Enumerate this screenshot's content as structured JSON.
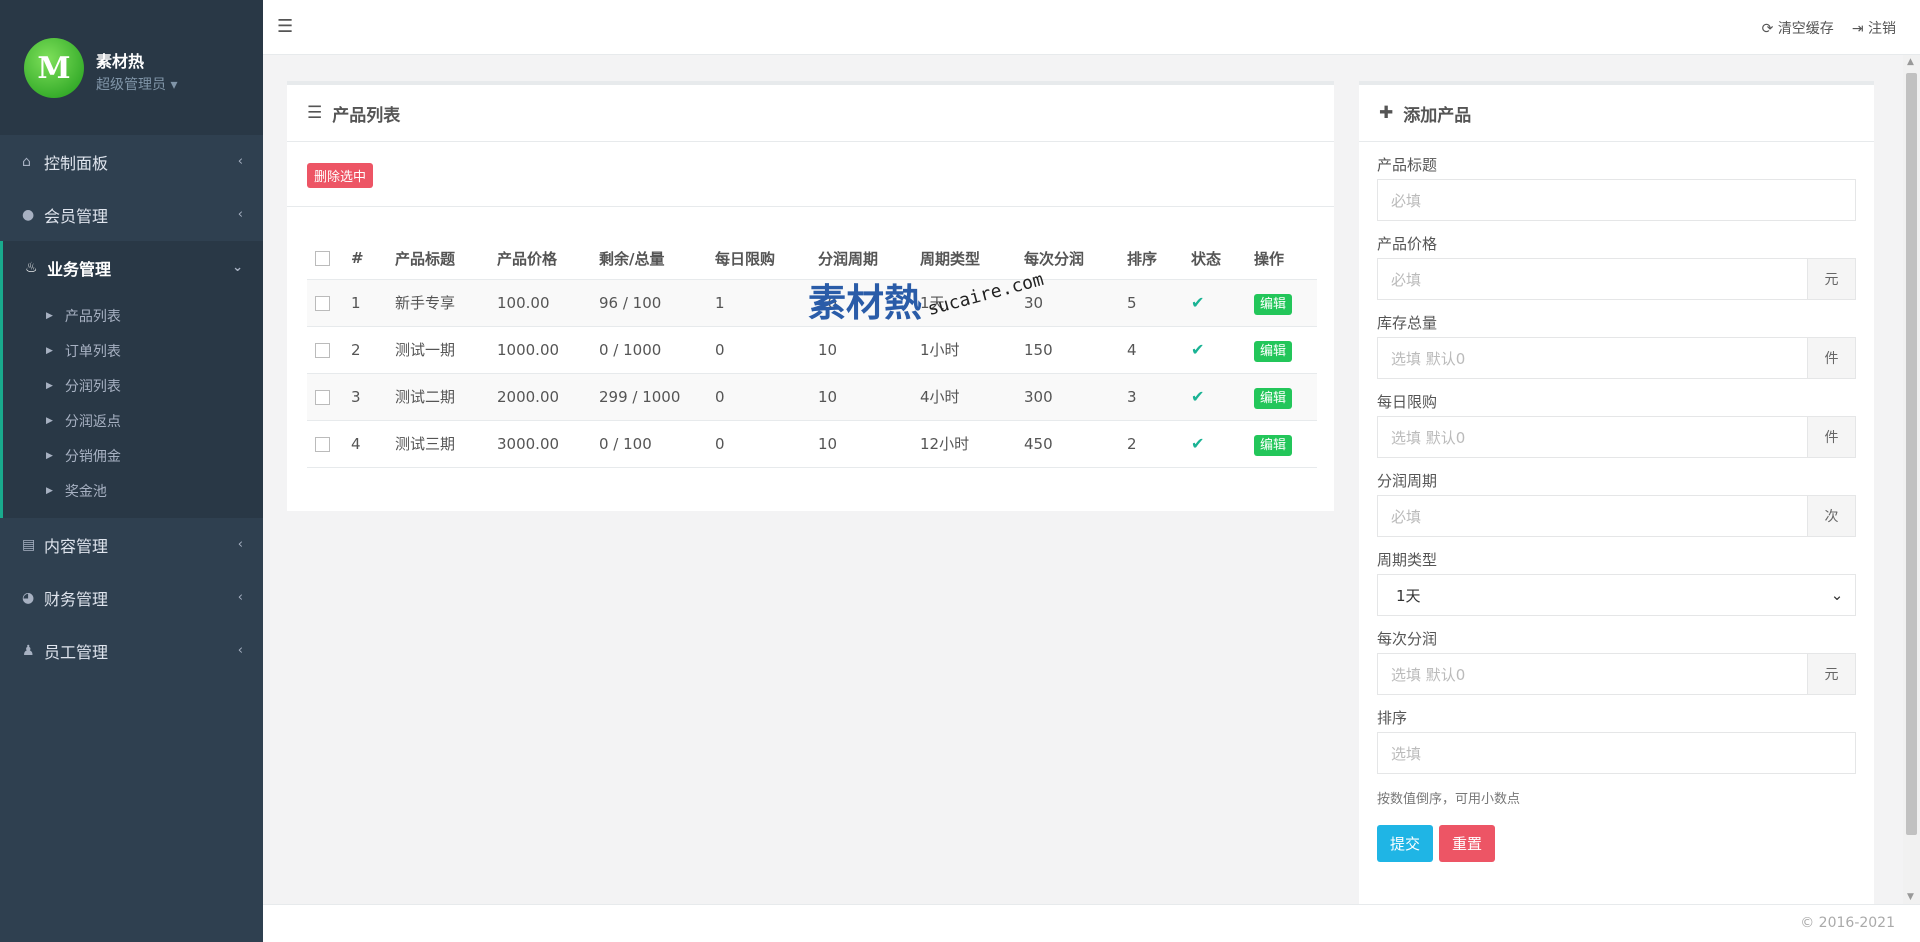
{
  "profile": {
    "name": "素材热",
    "role": "超级管理员"
  },
  "nav": {
    "items": [
      {
        "label": "控制面板"
      },
      {
        "label": "会员管理"
      },
      {
        "label": "业务管理"
      },
      {
        "label": "内容管理"
      },
      {
        "label": "财务管理"
      },
      {
        "label": "员工管理"
      }
    ],
    "submenu": [
      "产品列表",
      "订单列表",
      "分润列表",
      "分润返点",
      "分销佣金",
      "奖金池"
    ]
  },
  "topbar": {
    "clear_cache": "清空缓存",
    "logout": "注销"
  },
  "product_list": {
    "title": "产品列表",
    "delete_selected": "删除选中",
    "columns": [
      "#",
      "产品标题",
      "产品价格",
      "剩余/总量",
      "每日限购",
      "分润周期",
      "周期类型",
      "每次分润",
      "排序",
      "状态",
      "操作"
    ],
    "rows": [
      {
        "id": "1",
        "title": "新手专享",
        "price": "100.00",
        "stock": "96 / 100",
        "daily": "1",
        "cycle": "10",
        "type": "1天",
        "profit": "30",
        "sort": "5",
        "edit": "编辑"
      },
      {
        "id": "2",
        "title": "测试一期",
        "price": "1000.00",
        "stock": "0 / 1000",
        "daily": "0",
        "cycle": "10",
        "type": "1小时",
        "profit": "150",
        "sort": "4",
        "edit": "编辑"
      },
      {
        "id": "3",
        "title": "测试二期",
        "price": "2000.00",
        "stock": "299 / 1000",
        "daily": "0",
        "cycle": "10",
        "type": "4小时",
        "profit": "300",
        "sort": "3",
        "edit": "编辑"
      },
      {
        "id": "4",
        "title": "测试三期",
        "price": "3000.00",
        "stock": "0 / 100",
        "daily": "0",
        "cycle": "10",
        "type": "12小时",
        "profit": "450",
        "sort": "2",
        "edit": "编辑"
      }
    ]
  },
  "watermark": {
    "cn": "素材熱",
    "en": "sucaire.com"
  },
  "add_product": {
    "title": "添加产品",
    "fields": [
      {
        "label": "产品标题",
        "placeholder": "必填",
        "addon": ""
      },
      {
        "label": "产品价格",
        "placeholder": "必填",
        "addon": "元"
      },
      {
        "label": "库存总量",
        "placeholder": "选填 默认0",
        "addon": "件"
      },
      {
        "label": "每日限购",
        "placeholder": "选填 默认0",
        "addon": "件"
      },
      {
        "label": "分润周期",
        "placeholder": "必填",
        "addon": "次"
      },
      {
        "label": "周期类型",
        "value": "1天"
      },
      {
        "label": "每次分润",
        "placeholder": "选填 默认0",
        "addon": "元"
      },
      {
        "label": "排序",
        "placeholder": "选填",
        "addon": ""
      }
    ],
    "help": "按数值倒序，可用小数点",
    "submit": "提交",
    "reset": "重置"
  },
  "footer": {
    "copyright": "© 2016-2021"
  },
  "icons": [
    "home-icon",
    "user-icon",
    "fire-icon",
    "book-icon",
    "pie-chart-icon",
    "sitemap-icon",
    "list-icon",
    "plus-icon",
    "refresh-icon",
    "sign-out-icon",
    "check-icon"
  ]
}
